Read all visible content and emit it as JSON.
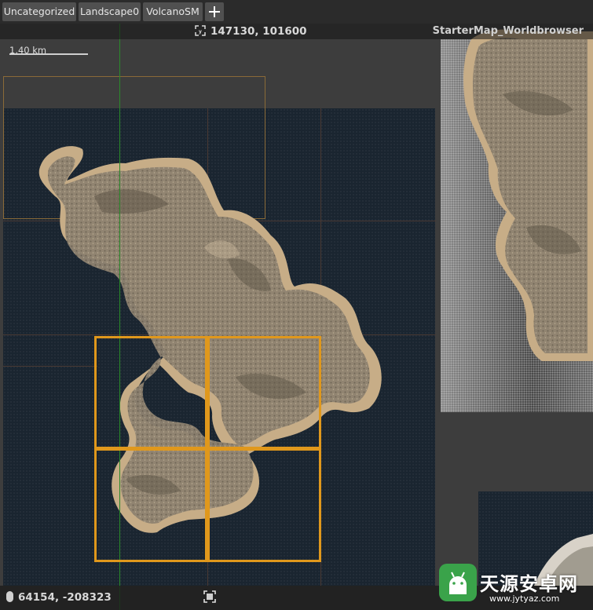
{
  "tabs": [
    {
      "label": "Uncategorized"
    },
    {
      "label": "Landscape0"
    },
    {
      "label": "VolcanoSM"
    }
  ],
  "viewport": {
    "top_coords": "147130, 101600",
    "map_name": "StarterMap_Worldbrowser",
    "scale_label": "1.40 km",
    "bottom_coords": "64154, -208323"
  },
  "icons": {
    "add_tab": "plus-icon",
    "top_coords": "crosshair-icon",
    "bottom_coords": "mouse-icon",
    "focus": "focus-frame-icon"
  },
  "colors": {
    "selection": "#e0981c",
    "world_axis": "#2a8a2a",
    "water": "#1a2530",
    "terrain": "#b29a78"
  },
  "watermark": {
    "title": "天源安卓网",
    "url": "www.jytyaz.com"
  }
}
